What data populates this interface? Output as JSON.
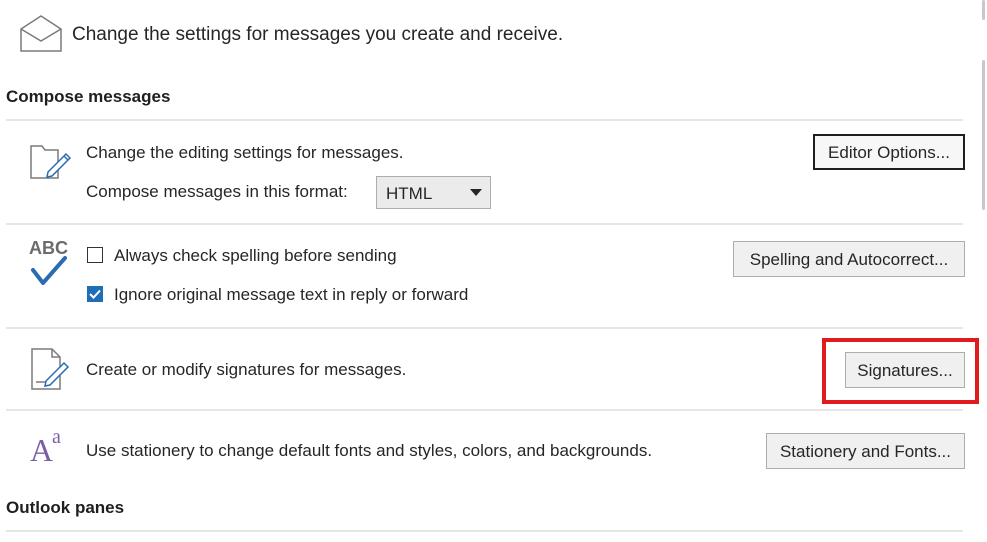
{
  "header": {
    "description": "Change the settings for messages you create and receive.",
    "icon": "envelope-icon"
  },
  "compose": {
    "title": "Compose messages",
    "editing": {
      "icon": "folder-pencil-icon",
      "description": "Change the editing settings for messages.",
      "format_label": "Compose messages in this format:",
      "format_value": "HTML",
      "editor_button": "Editor Options..."
    },
    "spelling": {
      "icon": "abc-check-icon",
      "icon_text": "ABC",
      "always_check": {
        "label": "Always check spelling before sending",
        "checked": false
      },
      "ignore_original": {
        "label": "Ignore original message text in reply or forward",
        "checked": true
      },
      "button": "Spelling and Autocorrect..."
    },
    "signatures": {
      "icon": "document-pencil-icon",
      "description": "Create or modify signatures for messages.",
      "button": "Signatures..."
    },
    "stationery": {
      "icon": "font-aa-icon",
      "icon_text_big": "A",
      "icon_text_small": "a",
      "description": "Use stationery to change default fonts and styles, colors, and backgrounds.",
      "button": "Stationery and Fonts..."
    }
  },
  "panes": {
    "title": "Outlook panes"
  },
  "colors": {
    "highlight": "#e01b1b",
    "checkbox_checked": "#1f6fb8",
    "icon_blue": "#2b6cb0"
  }
}
